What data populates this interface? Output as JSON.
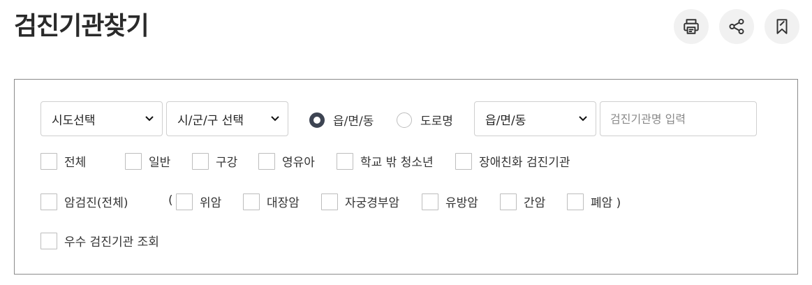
{
  "title": "검진기관찾기",
  "toolbar": {
    "print_icon": "printer-icon",
    "share_icon": "share-icon",
    "bookmark_icon": "bookmark-icon"
  },
  "filters": {
    "sido_select": "시도선택",
    "sigungu_select": "시/군/구 선택",
    "radio_options": [
      {
        "label": "읍/면/동",
        "checked": true
      },
      {
        "label": "도로명",
        "checked": false
      }
    ],
    "dong_select": "읍/면/동",
    "search_placeholder": "검진기관명 입력"
  },
  "checkboxes": {
    "row1": [
      "전체",
      "일반",
      "구강",
      "영유아",
      "학교 밖 청소년",
      "장애친화 검진기관"
    ],
    "row2_main": "암검진(전체)",
    "row2_open_paren": "(",
    "row2_items": [
      "위암",
      "대장암",
      "자궁경부암",
      "유방암",
      "간암",
      "폐암 )"
    ],
    "row3": [
      "우수 검진기관 조회"
    ]
  },
  "colors": {
    "title": "#2a2a2a",
    "border": "#8a8a8a",
    "radio_selected": "#3d4452",
    "tool_bg": "#f1f1f1"
  }
}
